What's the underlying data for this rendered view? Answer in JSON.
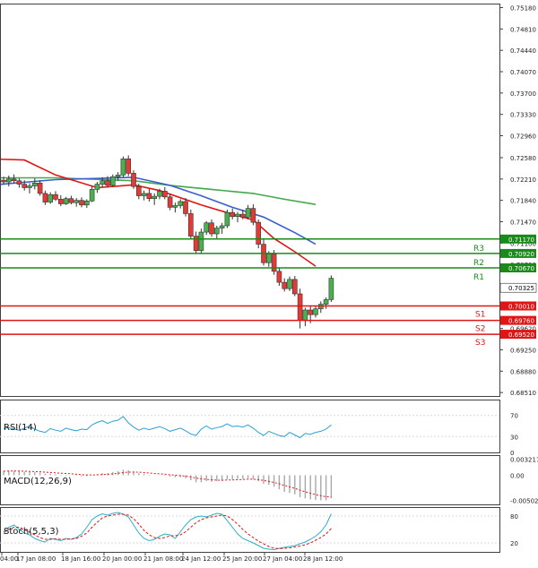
{
  "colors": {
    "background": "#ffffff",
    "axis": "#404040",
    "grid": "#d8d8d8",
    "bull": "#4caf50",
    "bear": "#e53935",
    "resistance": "#1a8a1a",
    "support": "#e01515",
    "ma_fast": "#e01515",
    "ma_mid": "#3a5fcd",
    "ma_slow": "#43a84a",
    "rsi": "#2aa0d8",
    "stoch_main": "#2ab0c8",
    "stoch_signal": "#e01515",
    "macd_hist": "#a8a8a8",
    "current_price_bg": "#ffffff"
  },
  "chart_data": {
    "type": "candlestick",
    "price_axis": {
      "ticks": [
        "0.75180",
        "0.74810",
        "0.74440",
        "0.74070",
        "0.73700",
        "0.73330",
        "0.72960",
        "0.72580",
        "0.72210",
        "0.71840",
        "0.71470",
        "0.71100",
        "0.70730",
        "0.70360",
        "0.69990",
        "0.69620",
        "0.69250",
        "0.68880",
        "0.68510"
      ],
      "range": [
        0.6845,
        0.7525
      ]
    },
    "time_axis": {
      "labels": [
        "04:00",
        "17 Jan 08:00",
        "18 Jan 16:00",
        "20 Jan 00:00",
        "21 Jan 08:00",
        "24 Jan 12:00",
        "25 Jan 20:00",
        "27 Jan 04:00",
        "28 Jan 12:00"
      ]
    },
    "levels": {
      "resistance": [
        {
          "name": "R3",
          "price": 0.7117,
          "label": "0.71170"
        },
        {
          "name": "R2",
          "price": 0.7092,
          "label": "0.70920"
        },
        {
          "name": "R1",
          "price": 0.7067,
          "label": "0.70670"
        }
      ],
      "support": [
        {
          "name": "S1",
          "price": 0.7001,
          "label": "0.70010"
        },
        {
          "name": "S2",
          "price": 0.6976,
          "label": "0.69760"
        },
        {
          "name": "S3",
          "price": 0.6952,
          "label": "0.69520"
        }
      ],
      "current": {
        "price": 0.70325,
        "label": "0.70325"
      }
    },
    "candles": [
      [
        0.7219,
        0.7225,
        0.7211,
        0.7216
      ],
      [
        0.7216,
        0.7227,
        0.7208,
        0.7221
      ],
      [
        0.7221,
        0.7229,
        0.7213,
        0.7218
      ],
      [
        0.7218,
        0.7222,
        0.7206,
        0.7212
      ],
      [
        0.7212,
        0.7219,
        0.7201,
        0.7206
      ],
      [
        0.7206,
        0.7214,
        0.7196,
        0.7209
      ],
      [
        0.7209,
        0.7222,
        0.7203,
        0.7214
      ],
      [
        0.7214,
        0.7219,
        0.7192,
        0.7196
      ],
      [
        0.7196,
        0.7201,
        0.7176,
        0.7181
      ],
      [
        0.7181,
        0.7198,
        0.7178,
        0.7194
      ],
      [
        0.7194,
        0.72,
        0.7183,
        0.7186
      ],
      [
        0.7186,
        0.7193,
        0.7174,
        0.7178
      ],
      [
        0.7178,
        0.719,
        0.7176,
        0.7187
      ],
      [
        0.7187,
        0.7192,
        0.7177,
        0.718
      ],
      [
        0.718,
        0.7188,
        0.7173,
        0.7184
      ],
      [
        0.7184,
        0.7189,
        0.7172,
        0.7176
      ],
      [
        0.7176,
        0.7186,
        0.7171,
        0.7183
      ],
      [
        0.7183,
        0.7208,
        0.7181,
        0.7203
      ],
      [
        0.7203,
        0.7216,
        0.7197,
        0.7212
      ],
      [
        0.7212,
        0.7224,
        0.7206,
        0.7218
      ],
      [
        0.7218,
        0.7226,
        0.7206,
        0.721
      ],
      [
        0.721,
        0.7229,
        0.7207,
        0.7225
      ],
      [
        0.7225,
        0.7233,
        0.7218,
        0.7228
      ],
      [
        0.7228,
        0.726,
        0.7224,
        0.7256
      ],
      [
        0.7256,
        0.7262,
        0.7226,
        0.7231
      ],
      [
        0.7231,
        0.7236,
        0.7204,
        0.7208
      ],
      [
        0.7208,
        0.7213,
        0.7186,
        0.7192
      ],
      [
        0.7192,
        0.7201,
        0.7184,
        0.7196
      ],
      [
        0.7196,
        0.7204,
        0.7182,
        0.7187
      ],
      [
        0.7187,
        0.7196,
        0.7176,
        0.7191
      ],
      [
        0.7191,
        0.7204,
        0.7186,
        0.72
      ],
      [
        0.72,
        0.7207,
        0.7186,
        0.719
      ],
      [
        0.719,
        0.7195,
        0.7167,
        0.7172
      ],
      [
        0.7172,
        0.718,
        0.7163,
        0.7175
      ],
      [
        0.7175,
        0.7186,
        0.717,
        0.7182
      ],
      [
        0.7182,
        0.7188,
        0.7156,
        0.7161
      ],
      [
        0.7161,
        0.7168,
        0.7116,
        0.7122
      ],
      [
        0.7122,
        0.713,
        0.7091,
        0.7097
      ],
      [
        0.7097,
        0.7135,
        0.7092,
        0.7129
      ],
      [
        0.7129,
        0.7148,
        0.7124,
        0.7145
      ],
      [
        0.7145,
        0.7151,
        0.7121,
        0.7126
      ],
      [
        0.7126,
        0.714,
        0.7117,
        0.7136
      ],
      [
        0.7136,
        0.7145,
        0.7126,
        0.714
      ],
      [
        0.714,
        0.7168,
        0.7136,
        0.7163
      ],
      [
        0.7163,
        0.717,
        0.7151,
        0.7156
      ],
      [
        0.7156,
        0.7164,
        0.7146,
        0.716
      ],
      [
        0.716,
        0.7168,
        0.7151,
        0.7155
      ],
      [
        0.7155,
        0.7176,
        0.7151,
        0.717
      ],
      [
        0.717,
        0.7177,
        0.7141,
        0.7146
      ],
      [
        0.7146,
        0.7151,
        0.7101,
        0.7108
      ],
      [
        0.7108,
        0.7116,
        0.7071,
        0.7076
      ],
      [
        0.7076,
        0.7096,
        0.7069,
        0.7091
      ],
      [
        0.7091,
        0.7098,
        0.7055,
        0.7061
      ],
      [
        0.7061,
        0.7068,
        0.7036,
        0.7042
      ],
      [
        0.7042,
        0.7049,
        0.7026,
        0.7031
      ],
      [
        0.7031,
        0.7052,
        0.7027,
        0.7047
      ],
      [
        0.7047,
        0.7053,
        0.7018,
        0.7022
      ],
      [
        0.7022,
        0.7031,
        0.6962,
        0.6976
      ],
      [
        0.6976,
        0.6998,
        0.6966,
        0.6994
      ],
      [
        0.6994,
        0.7002,
        0.6971,
        0.6986
      ],
      [
        0.6986,
        0.7002,
        0.6981,
        0.6996
      ],
      [
        0.6996,
        0.7009,
        0.6989,
        0.7004
      ],
      [
        0.7004,
        0.7016,
        0.6996,
        0.7012
      ],
      [
        0.7012,
        0.7054,
        0.7008,
        0.7049
      ]
    ],
    "ma_fast_points": [
      [
        -3,
        0.7256
      ],
      [
        4,
        0.7254
      ],
      [
        10,
        0.7228
      ],
      [
        18,
        0.7206
      ],
      [
        25,
        0.7211
      ],
      [
        30,
        0.7201
      ],
      [
        38,
        0.7176
      ],
      [
        44,
        0.716
      ],
      [
        48,
        0.715
      ],
      [
        52,
        0.7118
      ],
      [
        56,
        0.7095
      ],
      [
        60,
        0.707
      ]
    ],
    "ma_mid_points": [
      [
        -3,
        0.721
      ],
      [
        10,
        0.722
      ],
      [
        25,
        0.7224
      ],
      [
        32,
        0.721
      ],
      [
        38,
        0.7192
      ],
      [
        44,
        0.7172
      ],
      [
        50,
        0.7155
      ],
      [
        56,
        0.7128
      ],
      [
        60,
        0.7108
      ]
    ],
    "ma_slow_points": [
      [
        -3,
        0.7223
      ],
      [
        10,
        0.7223
      ],
      [
        25,
        0.7218
      ],
      [
        32,
        0.721
      ],
      [
        40,
        0.7203
      ],
      [
        48,
        0.7196
      ],
      [
        54,
        0.7186
      ],
      [
        60,
        0.7177
      ]
    ],
    "rsi": {
      "label": "RSI(14)",
      "ticks": [
        "70",
        "30",
        "0"
      ],
      "range": [
        0,
        100
      ],
      "values": [
        45,
        47,
        44,
        42,
        46,
        50,
        44,
        40,
        38,
        45,
        42,
        40,
        46,
        43,
        41,
        44,
        43,
        52,
        57,
        60,
        55,
        59,
        61,
        68,
        56,
        48,
        42,
        46,
        43,
        46,
        49,
        45,
        40,
        43,
        46,
        41,
        35,
        32,
        44,
        50,
        44,
        47,
        49,
        54,
        49,
        50,
        48,
        52,
        46,
        38,
        32,
        40,
        36,
        32,
        30,
        38,
        33,
        28,
        36,
        34,
        38,
        40,
        44,
        52
      ]
    },
    "macd": {
      "label": "MACD(12,26,9)",
      "ticks": [
        "0.003217",
        "0.00",
        "-0.005021"
      ],
      "range": [
        -0.0058,
        0.004
      ],
      "values": [
        0.0008,
        0.0009,
        0.0009,
        0.0008,
        0.0007,
        0.0006,
        0.0006,
        0.0005,
        0.0003,
        0.0003,
        0.0002,
        0.0001,
        0.0001,
        0.0,
        -0.0001,
        -0.0002,
        -0.0002,
        0.0,
        0.0002,
        0.0004,
        0.0004,
        0.0006,
        0.0008,
        0.0011,
        0.001,
        0.0007,
        0.0004,
        0.0003,
        0.0001,
        0.0,
        0.0,
        -0.0001,
        -0.0003,
        -0.0004,
        -0.0004,
        -0.0006,
        -0.001,
        -0.0014,
        -0.0014,
        -0.0012,
        -0.0013,
        -0.0012,
        -0.0011,
        -0.0008,
        -0.0008,
        -0.0007,
        -0.0007,
        -0.0006,
        -0.0008,
        -0.0012,
        -0.0017,
        -0.0019,
        -0.0023,
        -0.0028,
        -0.0033,
        -0.0035,
        -0.0038,
        -0.0044,
        -0.0046,
        -0.0048,
        -0.0049,
        -0.005,
        -0.005,
        -0.0046
      ]
    },
    "stoch": {
      "label": "Stoch(5,5,3)",
      "ticks": [
        "80",
        "20"
      ],
      "range": [
        0,
        100
      ],
      "main": [
        40,
        55,
        60,
        50,
        42,
        38,
        30,
        25,
        22,
        30,
        28,
        25,
        30,
        28,
        32,
        40,
        55,
        72,
        80,
        85,
        82,
        86,
        88,
        84,
        78,
        60,
        42,
        30,
        25,
        28,
        35,
        40,
        38,
        30,
        45,
        60,
        72,
        78,
        80,
        78,
        82,
        86,
        84,
        70,
        55,
        40,
        30,
        25,
        20,
        14,
        8,
        6,
        5,
        8,
        10,
        12,
        14,
        18,
        22,
        28,
        35,
        45,
        60,
        85
      ],
      "signal": [
        45,
        50,
        55,
        55,
        50,
        44,
        38,
        32,
        28,
        28,
        29,
        28,
        28,
        29,
        30,
        35,
        42,
        55,
        66,
        76,
        80,
        82,
        84,
        84,
        82,
        74,
        62,
        48,
        38,
        32,
        30,
        32,
        36,
        36,
        38,
        45,
        55,
        65,
        72,
        76,
        78,
        80,
        82,
        80,
        72,
        62,
        50,
        40,
        32,
        24,
        18,
        12,
        8,
        7,
        8,
        9,
        11,
        13,
        16,
        20,
        26,
        32,
        40,
        52
      ]
    }
  }
}
